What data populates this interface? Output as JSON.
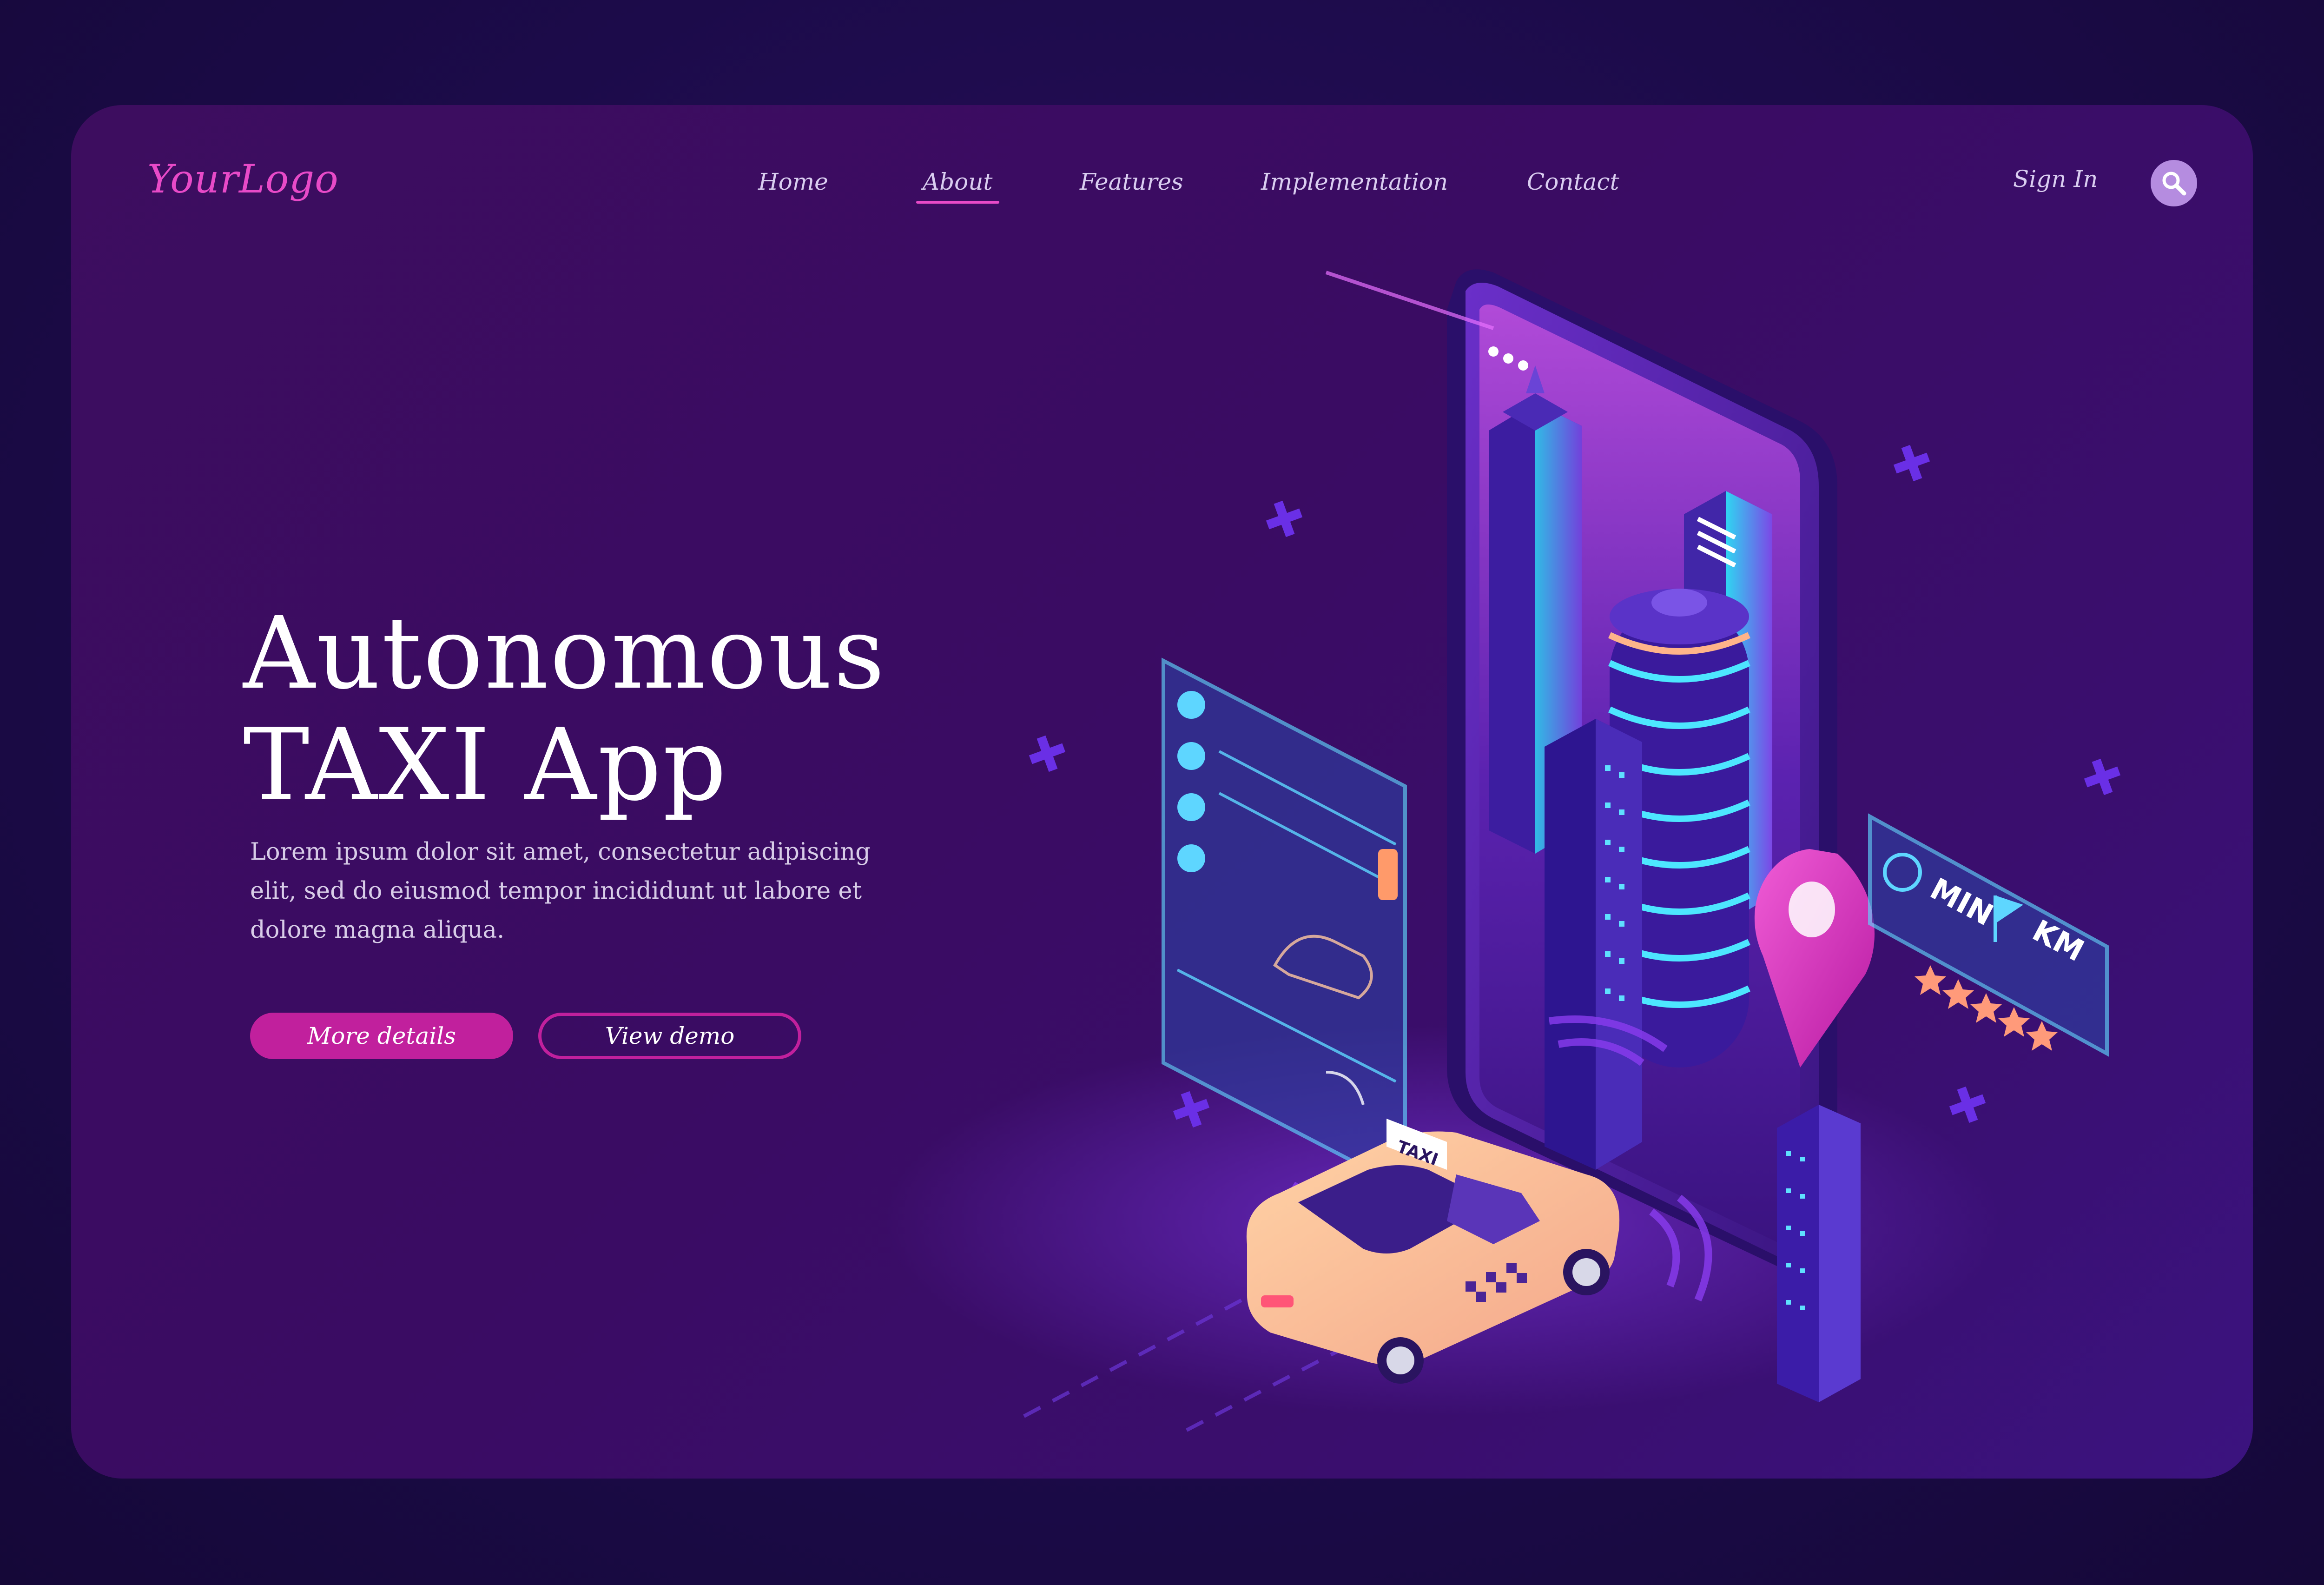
{
  "brand": {
    "logo": "YourLogo"
  },
  "nav": {
    "items": [
      {
        "label": "Home"
      },
      {
        "label": "About",
        "active": true
      },
      {
        "label": "Features"
      },
      {
        "label": "Implementation"
      },
      {
        "label": "Contact"
      }
    ],
    "signin_label": "Sign In"
  },
  "hero": {
    "title_line1": "Autonomous",
    "title_line2": "TAXI App",
    "description": "Lorem ipsum dolor sit amet, consectetur adipiscing elit, sed do eiusmod tempor incididunt ut labore et dolore magna aliqua.",
    "primary_button": "More details",
    "secondary_button": "View demo"
  },
  "illustration": {
    "taxi_sign": "TAXI",
    "info_panel": {
      "min_label": "MIN",
      "km_label": "KM",
      "rating_stars": 5
    }
  },
  "colors": {
    "accent": "#c1209d",
    "logo": "#e84ac8",
    "background": "#1c0b4a",
    "card": "#3a0c63",
    "cyan": "#4de6ff"
  },
  "icons": [
    "search-icon",
    "location-pin-icon",
    "clock-icon",
    "flag-icon",
    "star-icon",
    "taxi-car-icon",
    "traffic-light-icon"
  ]
}
